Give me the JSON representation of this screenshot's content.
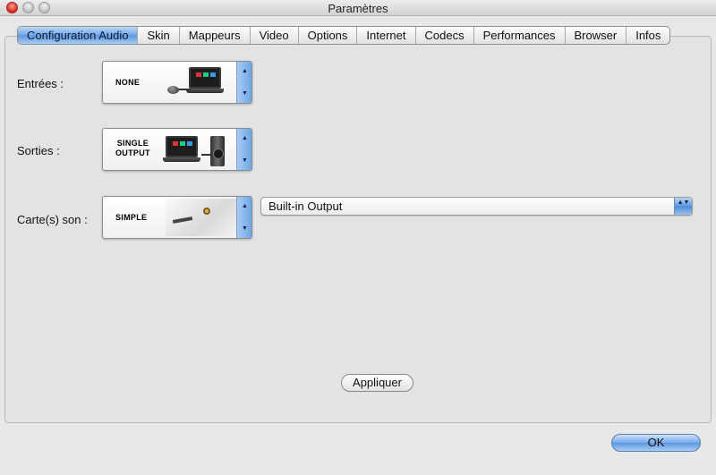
{
  "window": {
    "title": "Paramètres"
  },
  "tabs": [
    {
      "label": "Configuration Audio",
      "active": true
    },
    {
      "label": "Skin"
    },
    {
      "label": "Mappeurs"
    },
    {
      "label": "Video"
    },
    {
      "label": "Options"
    },
    {
      "label": "Internet"
    },
    {
      "label": "Codecs"
    },
    {
      "label": "Performances"
    },
    {
      "label": "Browser"
    },
    {
      "label": "Infos"
    }
  ],
  "audio": {
    "inputs": {
      "label": "Entrées :",
      "selector_line1": "NONE"
    },
    "outputs": {
      "label": "Sorties :",
      "selector_line1": "SINGLE",
      "selector_line2": "OUTPUT"
    },
    "soundcard": {
      "label": "Carte(s) son :",
      "selector_line1": "SIMPLE",
      "device_value": "Built-in Output"
    }
  },
  "buttons": {
    "apply": "Appliquer",
    "ok": "OK"
  },
  "icons": {
    "stepper_up": "▲",
    "stepper_down": "▼",
    "popup_arrows": "▲▼"
  },
  "colors": {
    "accent_blue": "#6fa6e6",
    "panel_bg": "#e3e3e3"
  }
}
